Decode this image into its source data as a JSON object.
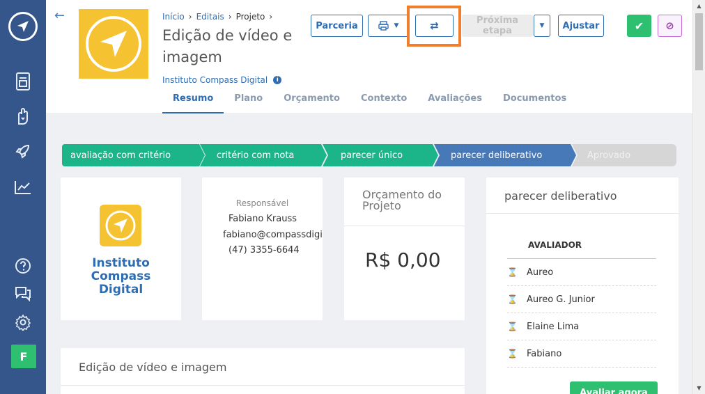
{
  "sidebar": {
    "avatar_letter": "F"
  },
  "header": {
    "breadcrumb": {
      "home": "Início",
      "editais": "Editais",
      "projeto": "Projeto"
    },
    "title": "Edição de vídeo e imagem",
    "organization": "Instituto Compass Digital",
    "buttons": {
      "parceria": "Parceria",
      "swap": "⇄",
      "proxima": "Próxima etapa",
      "ajustar": "Ajustar"
    },
    "tabs": [
      "Resumo",
      "Plano",
      "Orçamento",
      "Contexto",
      "Avaliações",
      "Documentos"
    ]
  },
  "pipeline": {
    "stages": [
      "avaliação com critério",
      "critério com nota",
      "parecer único",
      "parecer deliberativo",
      "Aprovado"
    ],
    "current": "parecer deliberativo"
  },
  "org_card": {
    "name": "Instituto Compass Digital"
  },
  "responsavel": {
    "label": "Responsável",
    "name": "Fabiano Krauss",
    "email": "fabiano@compassdigital.com",
    "phone": "(47) 3355-6644"
  },
  "orcamento": {
    "title": "Orçamento do Projeto",
    "value": "R$ 0,00"
  },
  "parecer": {
    "title": "parecer deliberativo",
    "header": "AVALIADOR",
    "evaluators": [
      "Aureo",
      "Aureo G. Junior",
      "Elaine Lima",
      "Fabiano"
    ],
    "button": "Avaliar agora"
  },
  "description": {
    "title": "Edição de vídeo e imagem"
  },
  "colors": {
    "sidebar": "#34568b",
    "primary": "#2f6db3",
    "success": "#2fbf71",
    "stage_done": "#1cb58a",
    "stage_current": "#4778b8",
    "highlight": "#f07f2c",
    "logo_yellow": "#f5c232"
  }
}
